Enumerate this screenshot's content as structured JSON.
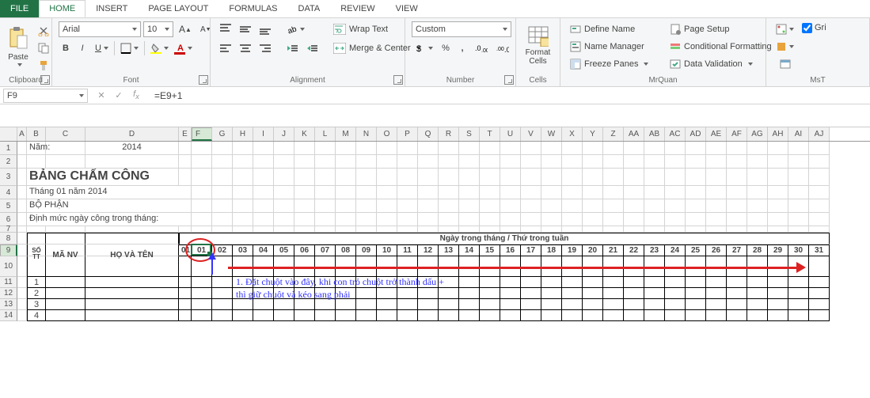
{
  "tabs": [
    "FILE",
    "HOME",
    "INSERT",
    "PAGE LAYOUT",
    "FORMULAS",
    "DATA",
    "REVIEW",
    "VIEW"
  ],
  "activeTab": 1,
  "ribbon": {
    "clipboard": {
      "label": "Clipboard",
      "paste": "Paste"
    },
    "font": {
      "label": "Font",
      "name": "Arial",
      "size": "10"
    },
    "alignment": {
      "label": "Alignment",
      "wrap": "Wrap Text",
      "merge": "Merge & Center"
    },
    "number": {
      "label": "Number",
      "format": "Custom"
    },
    "cells": {
      "label": "Cells",
      "format": "Format\nCells"
    },
    "mrquan": {
      "label": "MrQuan",
      "items": [
        "Define Name",
        "Name Manager",
        "Freeze Panes",
        "Page Setup",
        "Conditional Formatting",
        "Data Validation"
      ]
    },
    "mst": {
      "label": "MsT",
      "grid": "Gri"
    }
  },
  "namebox": "F9",
  "formula": "=E9+1",
  "colHeaders": [
    "A",
    "B",
    "C",
    "D",
    "E",
    "F",
    "G",
    "H",
    "I",
    "J",
    "K",
    "L",
    "M",
    "N",
    "O",
    "P",
    "Q",
    "R",
    "S",
    "T",
    "U",
    "V",
    "W",
    "X",
    "Y",
    "Z",
    "AA",
    "AB",
    "AC",
    "AD",
    "AE",
    "AF",
    "AG",
    "AH",
    "AI",
    "AJ"
  ],
  "sheet": {
    "r1": {
      "B": "Năm:",
      "D": "2014"
    },
    "r3": "BẢNG CHẤM CÔNG",
    "r4": "Tháng 01 năm 2014",
    "r5": "BỘ PHẬN",
    "r6": "Định mức ngày công trong tháng:",
    "r8": {
      "dayHeader": "Ngày trong tháng / Thứ trong tuần"
    },
    "r9": {
      "stt": "SỐ\nTT",
      "manv": "MÃ NV",
      "hoten": "HỌ VÀ TÊN"
    },
    "days": [
      "01",
      "02",
      "03",
      "04",
      "05",
      "06",
      "07",
      "08",
      "09",
      "10",
      "11",
      "12",
      "13",
      "14",
      "15",
      "16",
      "17",
      "18",
      "19",
      "20",
      "21",
      "22",
      "23",
      "24",
      "25",
      "26",
      "27",
      "28",
      "29",
      "30",
      "31"
    ],
    "rowNums": [
      "1",
      "2",
      "3",
      "4"
    ]
  },
  "annotation": "1. Đặt chuột vào đây, khi con trỏ chuột trở thành dấu +\nthì giữ chuột và kéo sang phải"
}
